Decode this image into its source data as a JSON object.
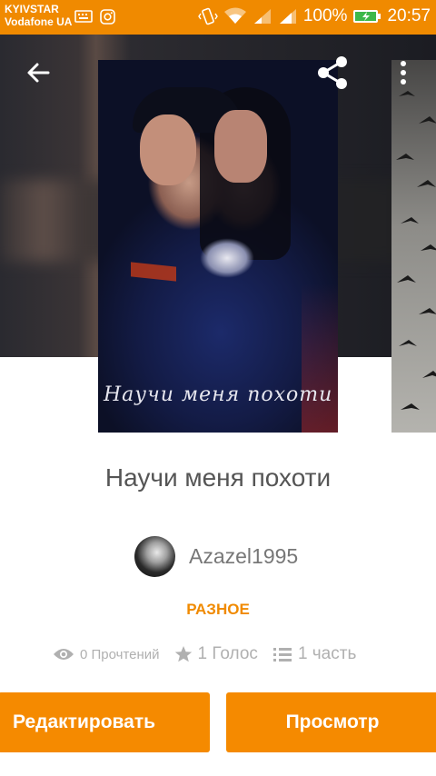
{
  "status_bar": {
    "carrier1": "KYIVSTAR",
    "carrier2": "Vodafone UA",
    "battery": "100%",
    "time": "20:57"
  },
  "header": {
    "back_icon": "arrow-back-icon",
    "share_icon": "share-icon",
    "more_icon": "more-vert-icon"
  },
  "cover": {
    "overlay_text": "Научи меня похоти"
  },
  "story": {
    "title": "Научи меня похоти",
    "author": "Azazel1995",
    "category": "РАЗНОЕ",
    "reads": "0 Прочтений",
    "votes": "1 Голос",
    "parts": "1 часть"
  },
  "buttons": {
    "edit": "Редактировать",
    "view": "Просмотр"
  },
  "colors": {
    "accent": "#f08a00",
    "button": "#f58a00",
    "text_gray": "#555555"
  }
}
